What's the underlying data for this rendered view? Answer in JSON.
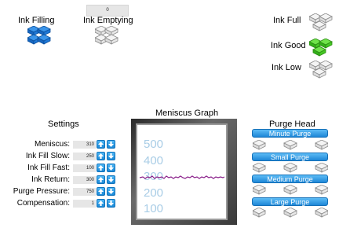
{
  "ink": {
    "filling_label": "Ink Filling",
    "emptying_label": "Ink Emptying",
    "counter": "0",
    "full_label": "Ink Full",
    "good_label": "Ink Good",
    "low_label": "Ink Low"
  },
  "settings": {
    "title": "Settings",
    "rows": [
      {
        "label": "Meniscus:",
        "value": "310"
      },
      {
        "label": "Ink Fill Slow:",
        "value": "250"
      },
      {
        "label": "Ink Fill Fast:",
        "value": "100"
      },
      {
        "label": "Ink Return:",
        "value": "300"
      },
      {
        "label": "Purge Pressure:",
        "value": "750"
      },
      {
        "label": "Compensation:",
        "value": "1"
      }
    ]
  },
  "graph": {
    "title": "Meniscus Graph",
    "ticks": [
      "500",
      "400",
      "300",
      "200",
      "100"
    ]
  },
  "purge": {
    "title": "Purge Head",
    "buttons": [
      "Minute Purge",
      "Small Purge",
      "Medium Purge",
      "Large Purge"
    ]
  },
  "colors": {
    "indicator_active_blue": "#1a78d8",
    "indicator_active_green": "#3fcf1f",
    "indicator_inactive": "#f2f2f2",
    "button_blue": "#1d86d6",
    "trace": "#8a1f8a"
  }
}
